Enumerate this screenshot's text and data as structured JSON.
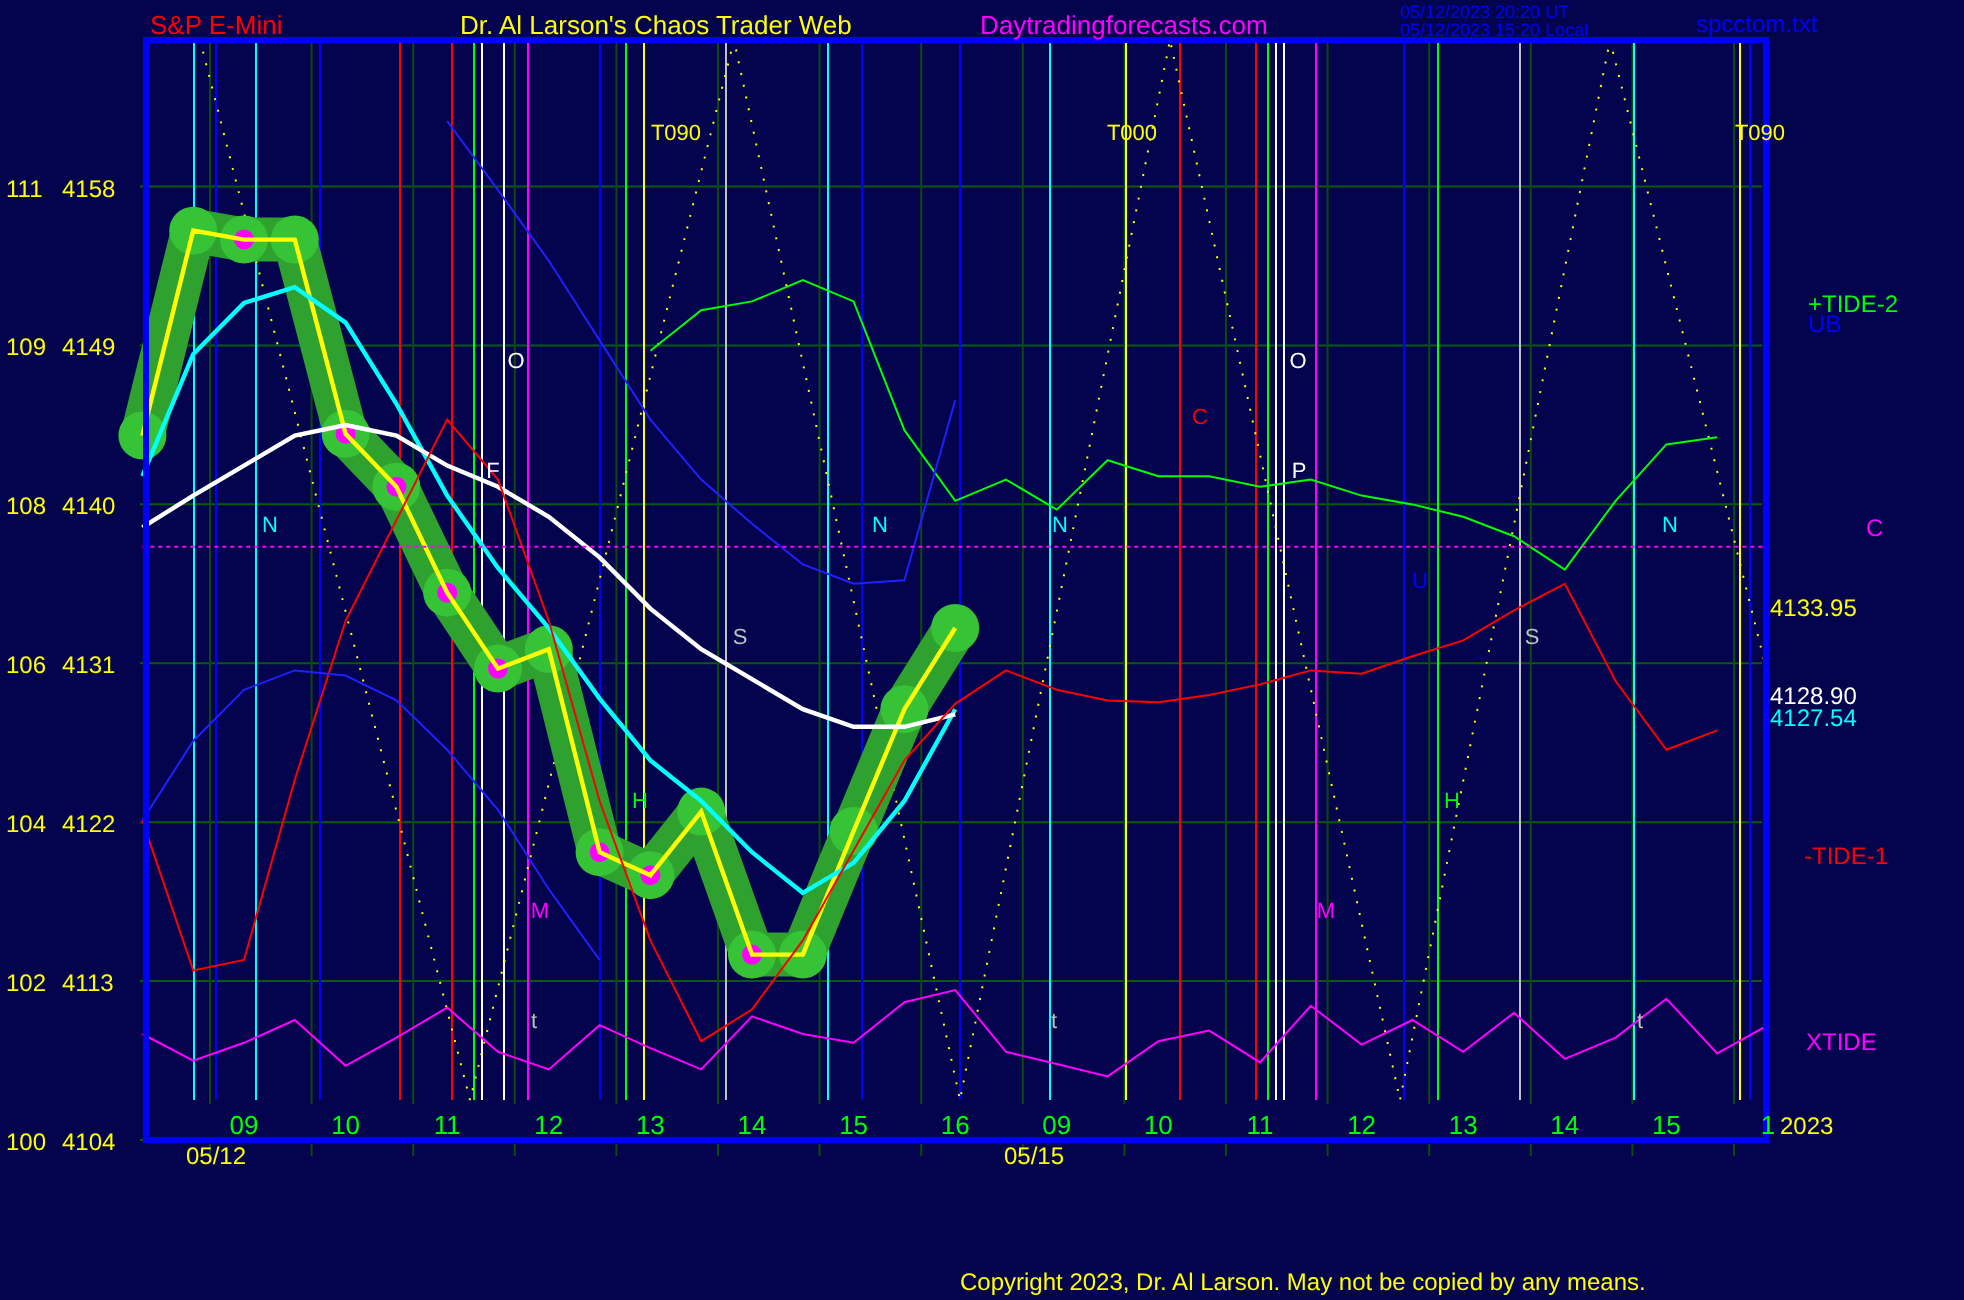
{
  "header": {
    "symbol": "S&P E-Mini",
    "title": "Dr. Al Larson's Chaos Trader Web",
    "site": "Daytradingforecasts.com",
    "time_ut": "05/12/2023 20:20 UT",
    "time_local": "05/12/2023 15:20 Local",
    "file": "spcctom.txt"
  },
  "chart": {
    "chart_data": {
      "type": "line",
      "categories": [
        null,
        null,
        "09",
        null,
        "10",
        null,
        "11",
        null,
        "12",
        null,
        "13",
        null,
        "14",
        null,
        "15",
        null,
        "16",
        null,
        "09",
        null,
        "10",
        null,
        "11",
        null,
        "12",
        null,
        "13",
        null,
        "14",
        null,
        "15",
        null,
        "1"
      ],
      "series": [
        {
          "color": "#ffff00",
          "marker": "circle",
          "values": [
            4143.9,
            4155.5,
            4155,
            4155,
            4144,
            4141,
            4135,
            4130.7,
            4131.8,
            4120.3,
            4119,
            4122.6,
            4114.5,
            4114.5,
            4121.5,
            4128.4,
            4133,
            null,
            null,
            null,
            null,
            null,
            null,
            null,
            null,
            null,
            null,
            null,
            null,
            null,
            null,
            null,
            null
          ]
        },
        {
          "color": "#00ffff",
          "values": [
            4141.6,
            4148.5,
            4151.4,
            4152.3,
            4150.3,
            4145.7,
            4140.5,
            4136.4,
            4133,
            4129,
            4125.5,
            4123.2,
            4120.3,
            4118,
            4119.7,
            4123.2,
            4128.4,
            null,
            null,
            null,
            null,
            null,
            null,
            null,
            null,
            null,
            null,
            null,
            null,
            null,
            null,
            null,
            null
          ]
        },
        {
          "color": "#ffffff",
          "values": [
            4138.7,
            4140.5,
            4142.2,
            4143.9,
            4144.5,
            4143.9,
            4142.2,
            4141,
            4139.3,
            4137,
            4134.1,
            4131.8,
            4130.1,
            4128.4,
            4127.4,
            4127.4,
            4128.1,
            null,
            null,
            null,
            null,
            null,
            null,
            null,
            null,
            null,
            null,
            null,
            null,
            null,
            null,
            null,
            null
          ]
        },
        {
          "color": "#00ff00",
          "values": [
            null,
            null,
            null,
            null,
            null,
            null,
            null,
            null,
            null,
            null,
            4148.7,
            4151,
            4151.5,
            4152.7,
            4151.5,
            4144.2,
            4140.2,
            4141.4,
            4139.7,
            4142.5,
            4141.6,
            4141.6,
            4141,
            4141.4,
            4140.5,
            4140,
            4139.3,
            4138.2,
            4136.3,
            4140.2,
            4143.4,
            4143.8,
            null
          ]
        },
        {
          "color": "#ff0000",
          "values": [
            4122.1,
            4113.6,
            4114.2,
            4124.4,
            4133.4,
            4139.1,
            4144.8,
            4141.4,
            4133.4,
            4123.2,
            4115.3,
            4109.6,
            4111.4,
            4115.3,
            4120.4,
            4125.5,
            4128.7,
            4130.6,
            4129.5,
            4128.9,
            4128.8,
            4129.2,
            4129.8,
            4130.6,
            4130.4,
            4131.4,
            4132.3,
            4134,
            4135.5,
            4130,
            4126.1,
            4127.2,
            null
          ]
        },
        {
          "color": "#2020ff",
          "values": [
            4122.1,
            4126.6,
            4129.5,
            4130.6,
            4130.3,
            4128.9,
            4126.1,
            4122.7,
            4118.2,
            4114.2,
            null,
            null,
            null,
            null,
            null,
            null,
            null,
            null,
            null,
            null,
            null,
            null,
            null,
            null,
            null,
            null,
            null,
            null,
            null,
            null,
            null,
            null,
            null
          ]
        },
        {
          "color": "#2020ff",
          "values": [
            null,
            null,
            null,
            null,
            null,
            null,
            4161.7,
            4157.8,
            4153.8,
            4149.3,
            4144.8,
            4141.4,
            4138.9,
            4136.6,
            4135.5,
            4135.7,
            4145.9,
            null,
            null,
            null,
            null,
            null,
            null,
            null,
            null,
            null,
            null,
            null,
            null,
            null,
            null,
            null,
            null
          ]
        },
        {
          "color": "#ff00ff",
          "values": [
            4110,
            4108.5,
            4109.5,
            4110.8,
            4108.2,
            4109.8,
            4111.5,
            4109,
            4108,
            4110.5,
            4109.2,
            4108,
            4111,
            4110,
            4109.5,
            4111.8,
            4112.5,
            4109,
            4108.3,
            4107.6,
            4109.6,
            4110.2,
            4108.4,
            4111.6,
            4109.4,
            4110.8,
            4109,
            4111.2,
            4108.6,
            4109.8,
            4112,
            4108.9,
            4110.5
          ]
        },
        {
          "color": "#ff00ff",
          "line_style": "dotted",
          "values": [
            4137.6,
            4137.6,
            4137.6,
            4137.6,
            4137.6,
            4137.6,
            4137.6,
            4137.6,
            4137.6,
            4137.6,
            4137.6,
            4137.6,
            4137.6,
            4137.6,
            4137.6,
            4137.6,
            4137.6,
            4137.6,
            4137.6,
            4137.6,
            4137.6,
            4137.6,
            4137.6,
            4137.6,
            4137.6,
            4137.6,
            4137.6,
            4137.6,
            4137.6,
            4137.6,
            4137.6,
            4137.6,
            4137.6
          ]
        }
      ],
      "grid": true,
      "yticks": [
        4158,
        4149,
        4140,
        4131,
        4122,
        4113,
        4104
      ],
      "ylim": [
        4104,
        4166.3
      ]
    },
    "left_scale": [
      "111",
      "109",
      "108",
      "106",
      "104",
      "102",
      "100"
    ],
    "markers": [
      {
        "text": "T090",
        "color": "#ffff00"
      },
      {
        "text": "T000",
        "color": "#ffff00"
      },
      {
        "text": "T090",
        "color": "#ffff00"
      },
      {
        "text": "N",
        "color": "#00ffff"
      },
      {
        "text": "N",
        "color": "#00ffff"
      },
      {
        "text": "N",
        "color": "#00ffff"
      },
      {
        "text": "N",
        "color": "#00ffff"
      },
      {
        "text": "O",
        "color": "#ffffff"
      },
      {
        "text": "O",
        "color": "#ffffff"
      },
      {
        "text": "F",
        "color": "#ffffff"
      },
      {
        "text": "P",
        "color": "#ffffff"
      },
      {
        "text": "C",
        "color": "#ff0000"
      },
      {
        "text": "S",
        "color": "#c0c0c0"
      },
      {
        "text": "S",
        "color": "#c0c0c0"
      },
      {
        "text": "U",
        "color": "#0000ff"
      },
      {
        "text": "H",
        "color": "#00ff00"
      },
      {
        "text": "H",
        "color": "#00ff00"
      },
      {
        "text": "M",
        "color": "#ff00ff"
      },
      {
        "text": "M",
        "color": "#ff00ff"
      },
      {
        "text": "t",
        "color": "#c0c0c0"
      },
      {
        "text": "t",
        "color": "#c0c0c0"
      },
      {
        "text": "t",
        "color": "#c0c0c0"
      }
    ],
    "dates": [
      "05/12",
      "05/15"
    ],
    "right_labels": [
      {
        "text": "+TIDE-2",
        "color": "#00ff00"
      },
      {
        "text": "UB",
        "color": "#0000ff"
      },
      {
        "text": "C",
        "color": "#ff00ff"
      },
      {
        "text": "4133.95",
        "color": "#ffff00"
      },
      {
        "text": "4128.90",
        "color": "#ffffff"
      },
      {
        "text": "4127.54",
        "color": "#00ffff"
      },
      {
        "text": "-TIDE-1",
        "color": "#ff0000"
      },
      {
        "text": "XTIDE",
        "color": "#ff00ff"
      },
      {
        "text": "2023",
        "color": "#ffff00"
      }
    ]
  },
  "footer": "Copyright 2023, Dr. Al Larson. May not be copied by any means."
}
